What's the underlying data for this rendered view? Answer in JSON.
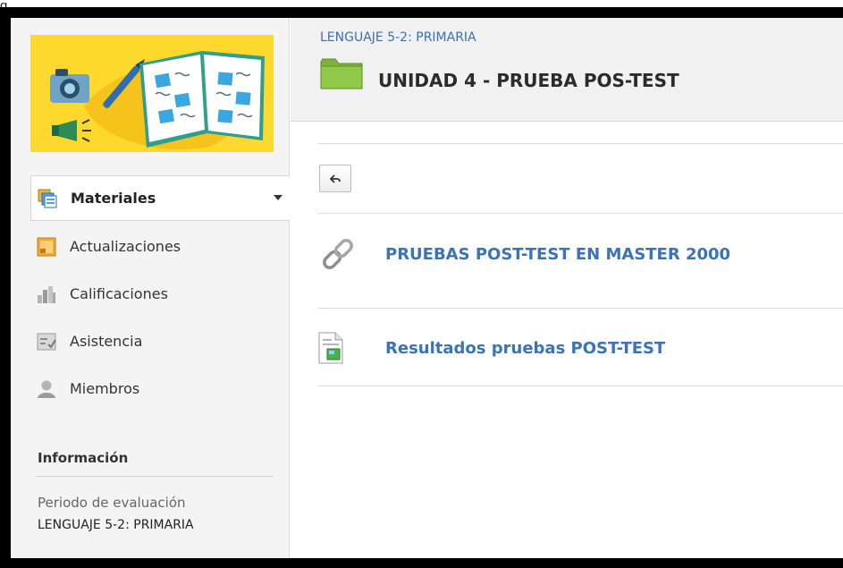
{
  "caption": "g",
  "course": {
    "breadcrumb": "LENGUAJE 5-2: PRIMARIA",
    "title": "UNIDAD 4 - PRUEBA POS-TEST"
  },
  "sidebar": {
    "items": [
      {
        "label": "Materiales",
        "icon": "materials-icon",
        "active": true
      },
      {
        "label": "Actualizaciones",
        "icon": "updates-icon"
      },
      {
        "label": "Calificaciones",
        "icon": "grades-icon"
      },
      {
        "label": "Asistencia",
        "icon": "attendance-icon"
      },
      {
        "label": "Miembros",
        "icon": "members-icon"
      }
    ],
    "info": {
      "heading": "Información",
      "period_label": "Periodo de evaluación",
      "period_value": "LENGUAJE 5-2: PRIMARIA"
    }
  },
  "materials": [
    {
      "label": "PRUEBAS POST-TEST EN MASTER 2000",
      "icon": "link-icon"
    },
    {
      "label": "Resultados pruebas POST-TEST",
      "icon": "file-icon"
    }
  ],
  "colors": {
    "link": "#3a73b8",
    "banner": "#fcd92c",
    "folder": "#8cc63f"
  }
}
